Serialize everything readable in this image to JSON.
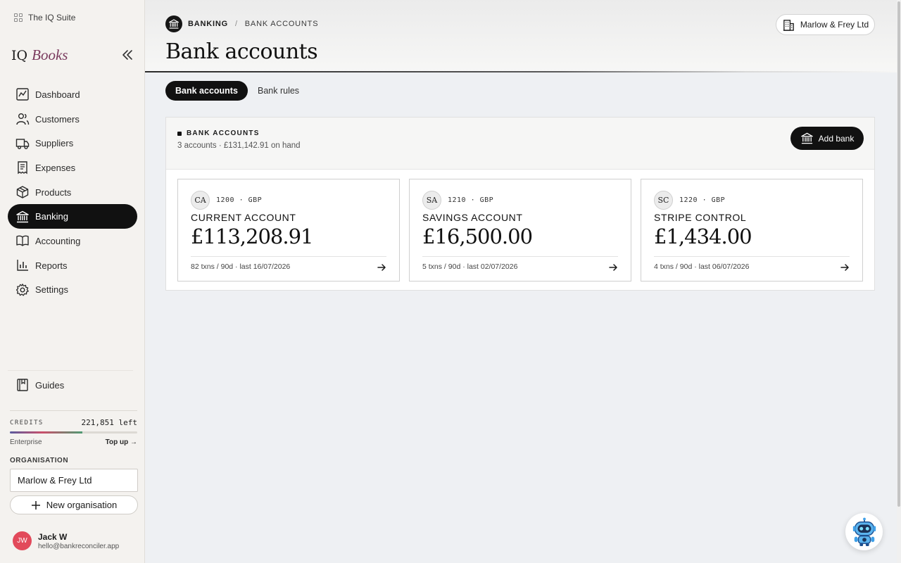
{
  "sidebar": {
    "suite_label": "The IQ Suite",
    "logo": {
      "prefix": "IQ",
      "emphasis": "Books"
    },
    "nav": [
      {
        "label": "Dashboard",
        "icon": "dashboard-icon"
      },
      {
        "label": "Customers",
        "icon": "users-icon"
      },
      {
        "label": "Suppliers",
        "icon": "truck-icon"
      },
      {
        "label": "Expenses",
        "icon": "receipt-icon"
      },
      {
        "label": "Products",
        "icon": "box-icon"
      },
      {
        "label": "Banking",
        "icon": "bank-icon",
        "active": true
      },
      {
        "label": "Accounting",
        "icon": "book-icon"
      },
      {
        "label": "Reports",
        "icon": "bar-chart-icon"
      },
      {
        "label": "Settings",
        "icon": "gear-icon"
      }
    ],
    "guides_label": "Guides",
    "credits": {
      "label": "CREDITS",
      "value": "221,851 left",
      "plan": "Enterprise",
      "top_up": "Top up →",
      "fill_fraction": 0.57
    },
    "organisation": {
      "label": "ORGANISATION",
      "current": "Marlow & Frey Ltd",
      "new_label": "New organisation"
    },
    "user": {
      "initials": "JW",
      "name": "Jack W",
      "email": "hello@bankreconciler.app",
      "avatar_color": "#e24a5b"
    }
  },
  "header": {
    "breadcrumb": {
      "section": "BANKING",
      "page": "BANK ACCOUNTS"
    },
    "title": "Bank accounts",
    "org_chip": "Marlow & Frey Ltd"
  },
  "tabs": [
    {
      "label": "Bank accounts",
      "active": true
    },
    {
      "label": "Bank rules",
      "active": false
    }
  ],
  "panel": {
    "title": "BANK ACCOUNTS",
    "summary": "3 accounts · £131,142.91 on hand",
    "add_button": "Add bank"
  },
  "accounts": [
    {
      "initials": "CA",
      "code": "1200 · GBP",
      "name": "CURRENT ACCOUNT",
      "balance": "£113,208.91",
      "footer": "82 txns / 90d  ·  last 16/07/2026"
    },
    {
      "initials": "SA",
      "code": "1210 · GBP",
      "name": "SAVINGS ACCOUNT",
      "balance": "£16,500.00",
      "footer": "5 txns / 90d  ·  last 02/07/2026"
    },
    {
      "initials": "SC",
      "code": "1220 · GBP",
      "name": "STRIPE CONTROL",
      "balance": "£1,434.00",
      "footer": "4 txns / 90d  ·  last 06/07/2026"
    }
  ],
  "colors": {
    "accent": "#111111",
    "brand_emphasis": "#7a3a5e",
    "background": "#eef0f3"
  }
}
